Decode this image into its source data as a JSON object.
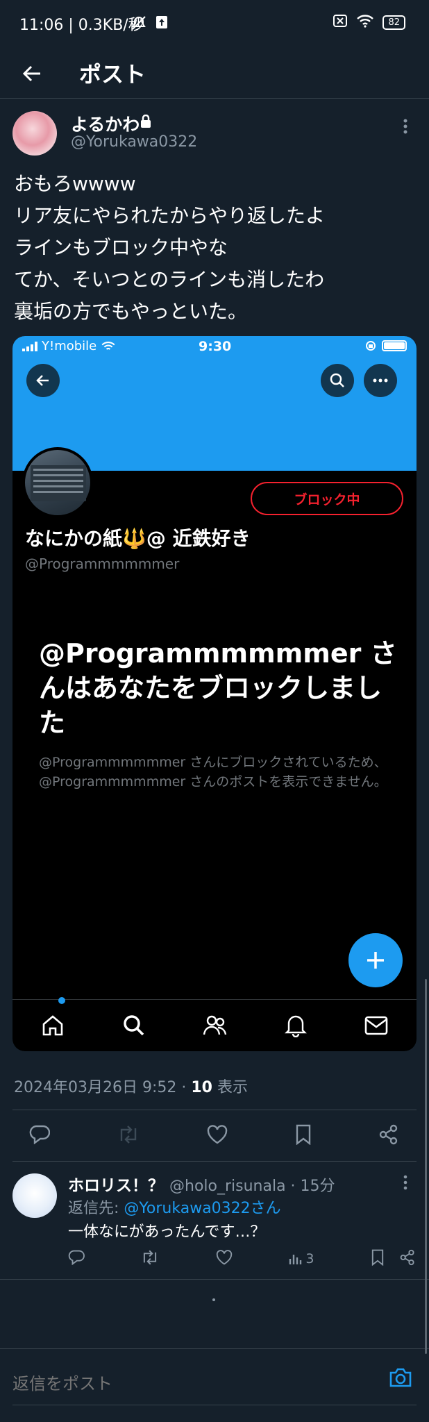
{
  "status_bar": {
    "left_text": "11:06 | 0.3KB/秒",
    "battery": "82"
  },
  "header": {
    "title": "ポスト"
  },
  "tweet": {
    "author_name": "よるかわ",
    "author_handle": "@Yorukawa0322",
    "text": "おもろwwww\nリア友にやられたからやり返したよ\nラインもブロック中やな\nてか、そいつとのラインも消したわ\n裏垢の方でもやっといた。",
    "timestamp": "2024年03月26日 9:52 · ",
    "views_count": "10",
    "views_label": " 表示"
  },
  "embedded_screenshot": {
    "carrier": "Y!mobile",
    "time": "9:30",
    "block_pill": "ブロック中",
    "profile_name": "なにかの紙🔱@ 近鉄好き",
    "profile_handle": "@Programmmmmmer",
    "headline": "@Programmmmmmer さんはあなたをブロックしました",
    "description": "@Programmmmmmer さんにブロックされているため、@Programmmmmmer さんのポストを表示できません。"
  },
  "reply": {
    "name": "ホロリス！？",
    "meta": "@holo_risunala · 15分",
    "reply_to_prefix": "返信先: ",
    "reply_to_handle": "@Yorukawa0322さん",
    "text": "一体なにがあったんです…？",
    "view_count": "3"
  },
  "compose": {
    "placeholder": "返信をポスト"
  },
  "colors": {
    "background": "#15202b",
    "accent": "#1d9bf0",
    "danger": "#f4212e",
    "muted": "#8b98a5"
  }
}
